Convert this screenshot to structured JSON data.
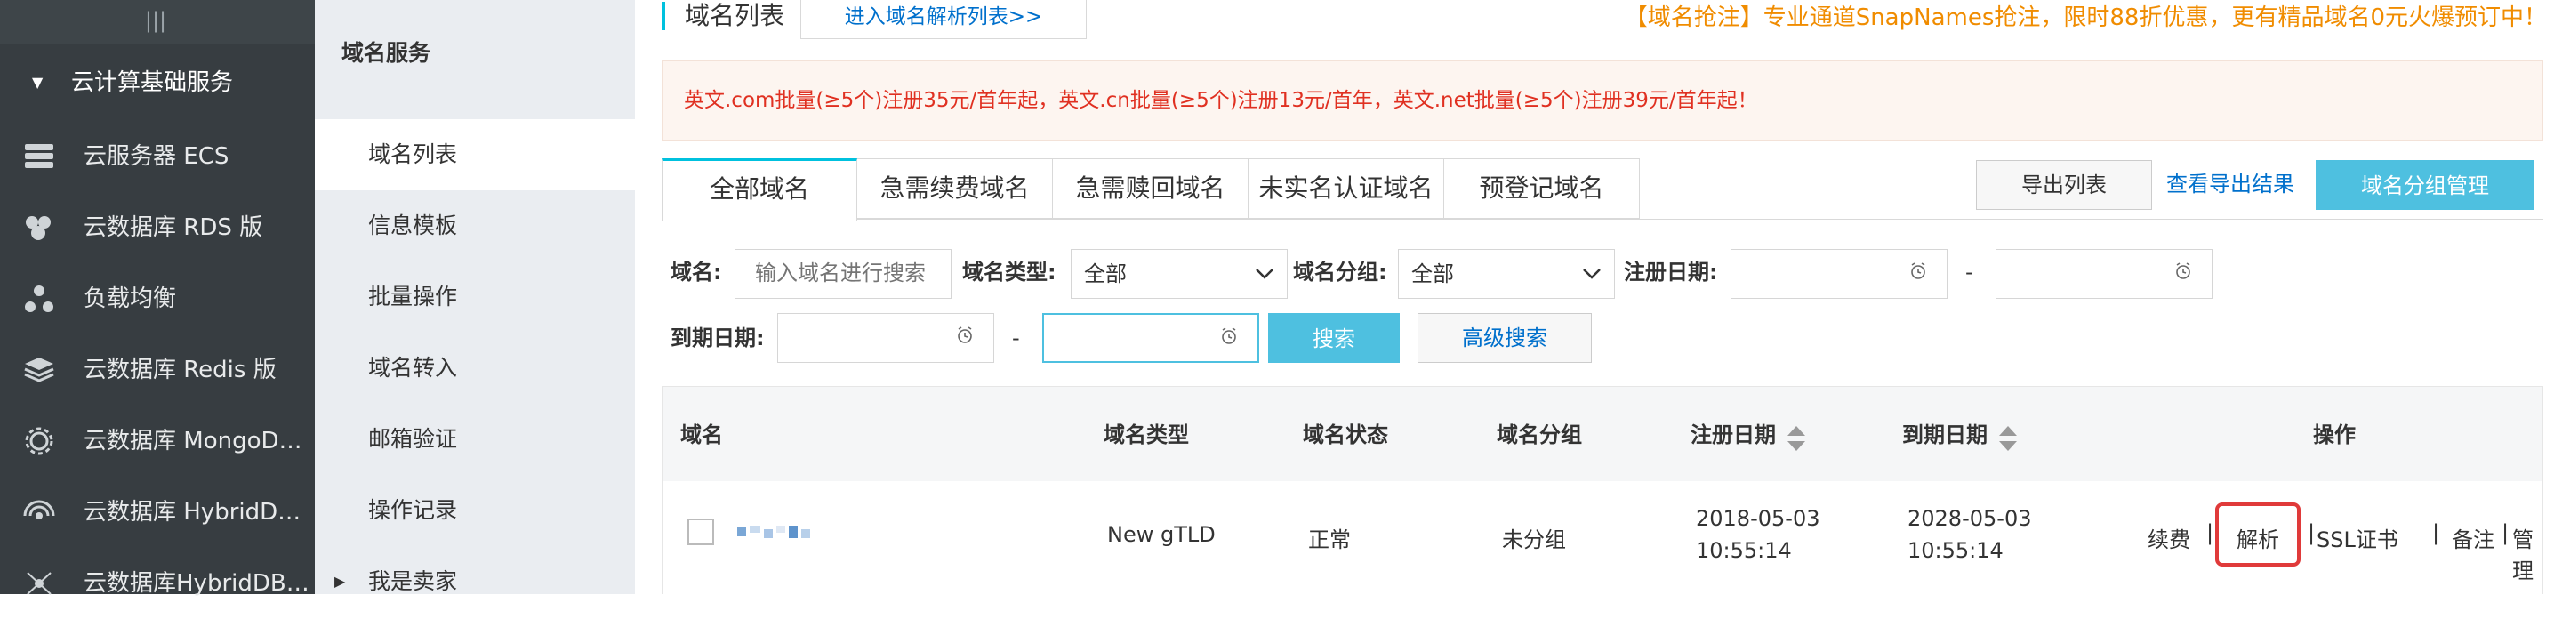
{
  "sidebar": {
    "collapse_glyph": "|||",
    "section_label": "云计算基础服务",
    "items": [
      {
        "label": "云服务器 ECS",
        "icon": "server-icon"
      },
      {
        "label": "云数据库 RDS 版",
        "icon": "database-icon"
      },
      {
        "label": "负载均衡",
        "icon": "load-balancer-icon"
      },
      {
        "label": "云数据库 Redis 版",
        "icon": "layers-icon"
      },
      {
        "label": "云数据库 MongoDB 版",
        "icon": "cog-icon"
      },
      {
        "label": "云数据库 HybridDB f...",
        "icon": "signal-icon"
      },
      {
        "label": "云数据库HybridDB fo...",
        "icon": "network-icon"
      }
    ]
  },
  "subnav": {
    "title": "域名服务",
    "items": [
      {
        "label": "域名列表",
        "active": true
      },
      {
        "label": "信息模板"
      },
      {
        "label": "批量操作"
      },
      {
        "label": "域名转入"
      },
      {
        "label": "邮箱验证"
      },
      {
        "label": "操作记录"
      },
      {
        "label": "我是卖家"
      }
    ]
  },
  "header": {
    "page_title": "域名列表",
    "resolve_link": "进入域名解析列表>>",
    "promo": "【域名抢注】专业通道SnapNames抢注，限时88折优惠，更有精品域名0元火爆预订中！"
  },
  "notice": "英文.com批量(≥5个)注册35元/首年起，英文.cn批量(≥5个)注册13元/首年，英文.net批量(≥5个)注册39元/首年起！",
  "tabs": [
    "全部域名",
    "急需续费域名",
    "急需赎回域名",
    "未实名认证域名",
    "预登记域名"
  ],
  "toolbar": {
    "export_label": "导出列表",
    "view_export_label": "查看导出结果",
    "group_manage_label": "域名分组管理"
  },
  "filters": {
    "domain_label": "域名:",
    "domain_placeholder": "输入域名进行搜索",
    "type_label": "域名类型:",
    "type_value": "全部",
    "group_label": "域名分组:",
    "group_value": "全部",
    "reg_date_label": "注册日期:",
    "expire_date_label": "到期日期:",
    "range_sep": "-",
    "search_label": "搜索",
    "advanced_label": "高级搜索"
  },
  "table": {
    "headers": [
      "域名",
      "域名类型",
      "域名状态",
      "域名分组",
      "注册日期",
      "到期日期",
      "操作"
    ],
    "rows": [
      {
        "domain": "",
        "type": "New gTLD",
        "status": "正常",
        "group": "未分组",
        "reg_date": "2018-05-03",
        "reg_time": "10:55:14",
        "exp_date": "2028-05-03",
        "exp_time": "10:55:14",
        "actions": [
          "续费",
          "解析",
          "SSL证书",
          "备注",
          "管理"
        ],
        "action_sep": "|"
      }
    ]
  },
  "colors": {
    "sidebar_bg": "#373d41",
    "subnav_bg": "#eaedf1",
    "accent": "#00c1de",
    "link": "#0070cc",
    "promo": "#f08c00",
    "notice_text": "#e03021",
    "highlight_box": "#e03a3a"
  }
}
